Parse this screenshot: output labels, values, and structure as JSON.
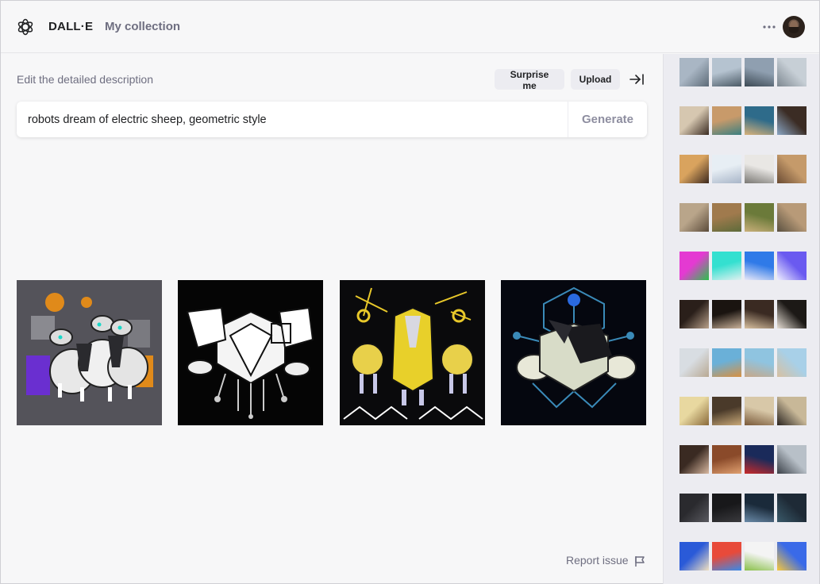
{
  "header": {
    "brand": "DALL·E",
    "collection_link": "My collection"
  },
  "editor": {
    "label": "Edit the detailed description",
    "surprise_label": "Surprise me",
    "upload_label": "Upload",
    "prompt_value": "robots dream of electric sheep, geometric style",
    "generate_label": "Generate"
  },
  "results": [
    {
      "name": "result-image-1",
      "style": "gray-orange-purple"
    },
    {
      "name": "result-image-2",
      "style": "black-white"
    },
    {
      "name": "result-image-3",
      "style": "black-yellow"
    },
    {
      "name": "result-image-4",
      "style": "navy-blue"
    }
  ],
  "footer": {
    "report_label": "Report issue"
  },
  "history": [
    {
      "row": 0,
      "colors": [
        [
          "#a9b6c4",
          "#5d6b78"
        ],
        [
          "#b5c3d0",
          "#4b5a66"
        ],
        [
          "#8f9fb0",
          "#3d4a55"
        ],
        [
          "#c7cfd6",
          "#7d8790"
        ]
      ]
    },
    {
      "row": 1,
      "colors": [
        [
          "#d6c7b0",
          "#3b2c22"
        ],
        [
          "#c89a6a",
          "#3a7f80"
        ],
        [
          "#2e6b8a",
          "#d8b27a"
        ],
        [
          "#3b2c24",
          "#8aa6c4"
        ]
      ]
    },
    {
      "row": 2,
      "colors": [
        [
          "#d9a35e",
          "#3d2a1f"
        ],
        [
          "#e7eef4",
          "#a8b5c8"
        ],
        [
          "#e9e7e4",
          "#7a7874"
        ],
        [
          "#c59a6a",
          "#6a4b33"
        ]
      ]
    },
    {
      "row": 3,
      "colors": [
        [
          "#b9a58a",
          "#5b4b3a"
        ],
        [
          "#a07a4d",
          "#5d6b3a"
        ],
        [
          "#6b7a3a",
          "#c9b07a"
        ],
        [
          "#b89a78",
          "#5a5040"
        ]
      ]
    },
    {
      "row": 4,
      "colors": [
        [
          "#e43ad2",
          "#2ac24a"
        ],
        [
          "#34e0d0",
          "#e0f0f0"
        ],
        [
          "#2f7ae8",
          "#e8e8f8"
        ],
        [
          "#6a5af0",
          "#f0f0ff"
        ]
      ]
    },
    {
      "row": 5,
      "colors": [
        [
          "#2a1f1a",
          "#b8a08a"
        ],
        [
          "#1a1410",
          "#c8b098"
        ],
        [
          "#3a2a22",
          "#d8c0a0"
        ],
        [
          "#1c1916",
          "#e8e0d6"
        ]
      ]
    },
    {
      "row": 6,
      "colors": [
        [
          "#d8dde2",
          "#b8a892"
        ],
        [
          "#6ab0d8",
          "#d89040"
        ],
        [
          "#8fc4e0",
          "#c8a888"
        ],
        [
          "#a8d0e8",
          "#d8c0a0"
        ]
      ]
    },
    {
      "row": 7,
      "colors": [
        [
          "#e8d8a0",
          "#8a6a3a"
        ],
        [
          "#4a3a2a",
          "#c8a878"
        ],
        [
          "#d8c8a8",
          "#7a5a3a"
        ],
        [
          "#c8b898",
          "#2a2420"
        ]
      ]
    },
    {
      "row": 8,
      "colors": [
        [
          "#3a2a22",
          "#d8b8a0"
        ],
        [
          "#8a4a2a",
          "#e0a070"
        ],
        [
          "#1a2a5a",
          "#c82a2a"
        ],
        [
          "#b8c0c8",
          "#3a4048"
        ]
      ]
    },
    {
      "row": 9,
      "colors": [
        [
          "#2a2a2e",
          "#5a5a60"
        ],
        [
          "#18181a",
          "#3a3a3e"
        ],
        [
          "#1a2a3a",
          "#6a8aa8"
        ],
        [
          "#1e2a36",
          "#3a5a6a"
        ]
      ]
    },
    {
      "row": 10,
      "colors": [
        [
          "#2a5ad8",
          "#f0e0c0"
        ],
        [
          "#e84a3a",
          "#3a8ae8"
        ],
        [
          "#f4f4f4",
          "#8ac04a"
        ],
        [
          "#3a6ae8",
          "#f8c83a"
        ]
      ]
    }
  ]
}
